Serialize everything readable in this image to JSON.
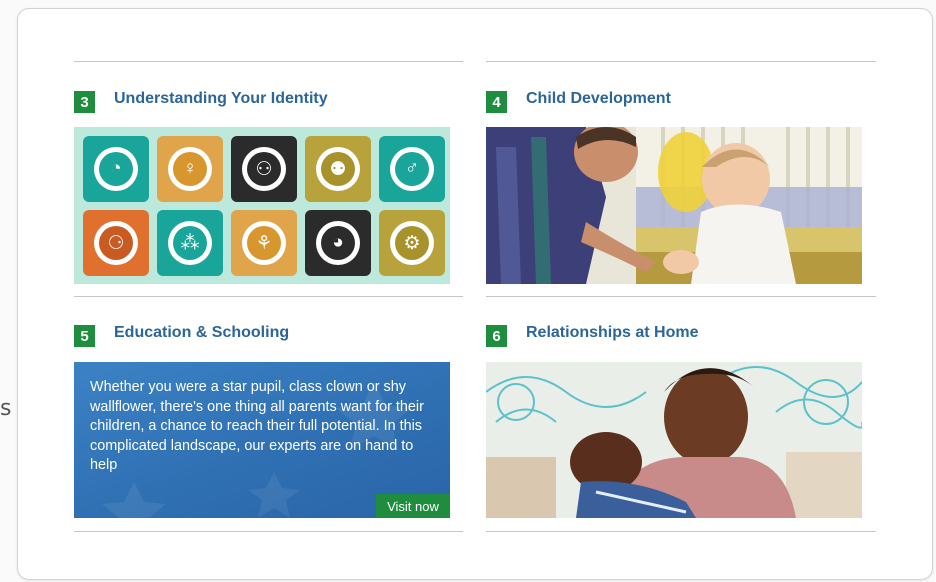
{
  "stray_char": "s",
  "sections": [
    {
      "number": "3",
      "title": "Understanding Your Identity"
    },
    {
      "number": "4",
      "title": "Child Development"
    },
    {
      "number": "5",
      "title": "Education & Schooling",
      "body": "Whether you were a star pupil, class clown or shy wallflower, there's one thing all parents want for their children, a chance to reach their full potential. In this complicated landscape, our experts are on hand to help",
      "cta": "Visit now"
    },
    {
      "number": "6",
      "title": "Relationships at Home"
    }
  ],
  "identity_icons": [
    {
      "icon": "head-profile-icon",
      "tile": "#1aa59a",
      "inner": "#1aa59a"
    },
    {
      "icon": "female-figure-icon",
      "tile": "#e0a54a",
      "inner": "#d8962e"
    },
    {
      "icon": "couple-icon",
      "tile": "#2b2b2b",
      "inner": "#2b2b2b"
    },
    {
      "icon": "parents-icon",
      "tile": "#b7a23b",
      "inner": "#a8922c"
    },
    {
      "icon": "businessman-icon",
      "tile": "#1aa59a",
      "inner": "#1aa59a"
    },
    {
      "icon": "family-icon",
      "tile": "#e0702e",
      "inner": "#c85a22"
    },
    {
      "icon": "family-group-icon",
      "tile": "#1aa59a",
      "inner": "#1aa59a"
    },
    {
      "icon": "stroller-icon",
      "tile": "#e0a54a",
      "inner": "#d8962e"
    },
    {
      "icon": "person-seated-icon",
      "tile": "#2b2b2b",
      "inner": "#2b2b2b"
    },
    {
      "icon": "gear-person-icon",
      "tile": "#b7a23b",
      "inner": "#a8922c"
    }
  ],
  "colors": {
    "accent_green": "#1e8e3e",
    "title_blue": "#2c6598",
    "panel_blue": "#2f70b3"
  }
}
